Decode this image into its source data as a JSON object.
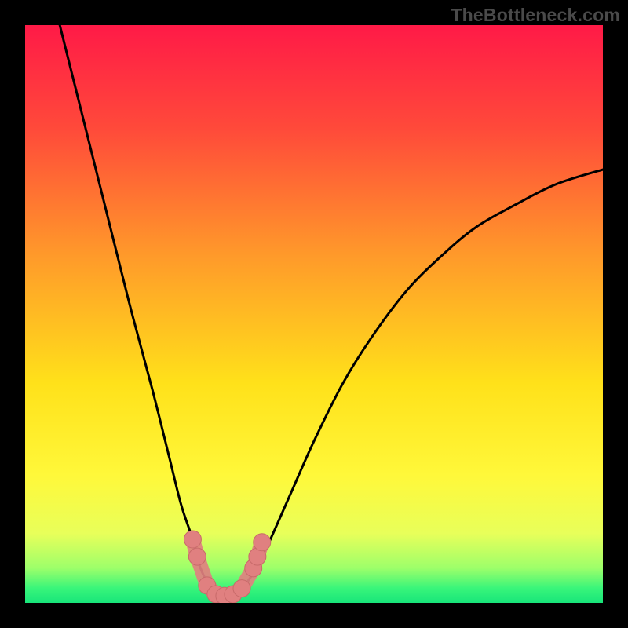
{
  "watermark": "TheBottleneck.com",
  "colors": {
    "frame": "#000000",
    "gradient_stops": [
      {
        "offset": 0.0,
        "color": "#ff1a47"
      },
      {
        "offset": 0.18,
        "color": "#ff4a3a"
      },
      {
        "offset": 0.4,
        "color": "#ff9a2a"
      },
      {
        "offset": 0.62,
        "color": "#ffe11a"
      },
      {
        "offset": 0.78,
        "color": "#fff83a"
      },
      {
        "offset": 0.88,
        "color": "#e8ff5a"
      },
      {
        "offset": 0.94,
        "color": "#9dff6a"
      },
      {
        "offset": 0.975,
        "color": "#38f57a"
      },
      {
        "offset": 1.0,
        "color": "#18e57a"
      }
    ],
    "curve": "#000000",
    "marker_fill": "#e08080",
    "marker_stroke": "#c86a6a"
  },
  "chart_data": {
    "type": "line",
    "title": "",
    "xlabel": "",
    "ylabel": "",
    "xlim": [
      0,
      100
    ],
    "ylim": [
      0,
      100
    ],
    "series": [
      {
        "name": "bottleneck-curve",
        "x": [
          6,
          10,
          14,
          18,
          22,
          25,
          27,
          29,
          30,
          31,
          32,
          33,
          34,
          35,
          36,
          37,
          38,
          40,
          42,
          46,
          50,
          55,
          60,
          66,
          72,
          78,
          85,
          92,
          100
        ],
        "y": [
          100,
          84,
          68,
          52,
          37,
          25,
          17,
          11,
          7,
          4.5,
          2.5,
          1.5,
          1,
          1,
          1.2,
          2,
          3,
          6,
          10,
          19,
          28,
          38,
          46,
          54,
          60,
          65,
          69,
          72.5,
          75
        ]
      }
    ],
    "markers": {
      "name": "highlighted-segment",
      "points": [
        {
          "x": 29.0,
          "y": 11.0
        },
        {
          "x": 29.8,
          "y": 8.0
        },
        {
          "x": 31.5,
          "y": 3.0
        },
        {
          "x": 33.0,
          "y": 1.5
        },
        {
          "x": 34.5,
          "y": 1.2
        },
        {
          "x": 36.0,
          "y": 1.5
        },
        {
          "x": 37.5,
          "y": 2.5
        },
        {
          "x": 39.5,
          "y": 6.0
        },
        {
          "x": 40.2,
          "y": 8.0
        },
        {
          "x": 41.0,
          "y": 10.5
        }
      ]
    }
  }
}
